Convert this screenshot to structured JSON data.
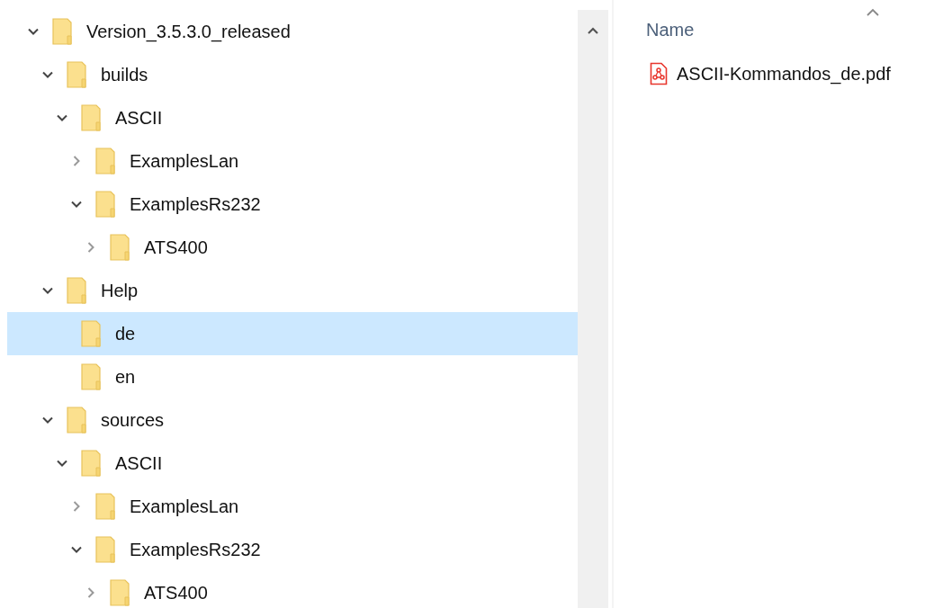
{
  "tree": [
    {
      "label": "Version_3.5.3.0_released",
      "expanded": true,
      "has_children": true,
      "selected": false,
      "children": [
        {
          "label": "builds",
          "expanded": true,
          "has_children": true,
          "selected": false,
          "children": [
            {
              "label": "ASCII",
              "expanded": true,
              "has_children": true,
              "selected": false,
              "children": [
                {
                  "label": "ExamplesLan",
                  "expanded": false,
                  "has_children": true,
                  "selected": false
                },
                {
                  "label": "ExamplesRs232",
                  "expanded": true,
                  "has_children": true,
                  "selected": false,
                  "children": [
                    {
                      "label": "ATS400",
                      "expanded": false,
                      "has_children": true,
                      "selected": false
                    }
                  ]
                }
              ]
            }
          ]
        },
        {
          "label": "Help",
          "expanded": true,
          "has_children": true,
          "selected": false,
          "children": [
            {
              "label": "de",
              "selected": true
            },
            {
              "label": "en",
              "selected": false
            }
          ]
        },
        {
          "label": "sources",
          "expanded": true,
          "has_children": true,
          "selected": false,
          "children": [
            {
              "label": "ASCII",
              "expanded": true,
              "has_children": true,
              "selected": false,
              "children": [
                {
                  "label": "ExamplesLan",
                  "expanded": false,
                  "has_children": true,
                  "selected": false
                },
                {
                  "label": "ExamplesRs232",
                  "expanded": true,
                  "has_children": true,
                  "selected": false,
                  "children": [
                    {
                      "label": "ATS400",
                      "expanded": false,
                      "has_children": true,
                      "selected": false
                    }
                  ]
                }
              ]
            }
          ]
        }
      ]
    }
  ],
  "file_list": {
    "column_header": "Name",
    "files": [
      {
        "name": "ASCII-Kommandos_de.pdf",
        "kind": "pdf"
      }
    ]
  }
}
